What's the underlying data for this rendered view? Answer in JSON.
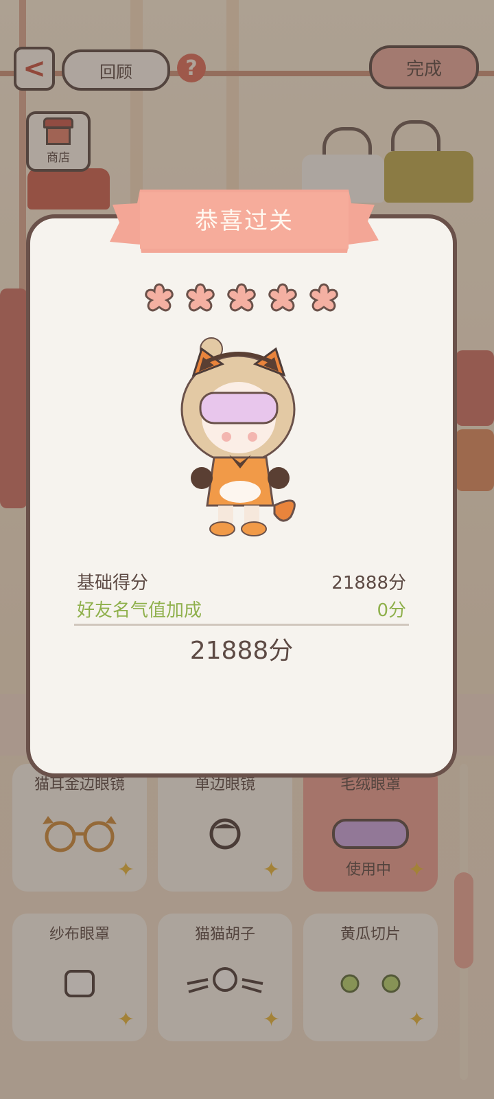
{
  "header": {
    "back_label": "<",
    "review_label": "回顾",
    "help_label": "?",
    "done_label": "完成"
  },
  "shop": {
    "label": "商店"
  },
  "result": {
    "title": "恭喜过关",
    "stars_earned": 5,
    "stars_total": 5,
    "base_score_label": "基础得分",
    "base_score_value": "21888分",
    "bonus_label": "好友名气值加成",
    "bonus_value": "0分",
    "total_value": "21888分"
  },
  "items": [
    {
      "name": "猫耳金边眼镜",
      "icon": "cat-ear-glasses-icon",
      "status": ""
    },
    {
      "name": "单边眼镜",
      "icon": "monocle-icon",
      "status": ""
    },
    {
      "name": "毛绒眼罩",
      "icon": "plush-eye-mask-icon",
      "status": "使用中"
    },
    {
      "name": "纱布眼罩",
      "icon": "gauze-eye-patch-icon",
      "status": ""
    },
    {
      "name": "猫猫胡子",
      "icon": "cat-whiskers-icon",
      "status": ""
    },
    {
      "name": "黄瓜切片",
      "icon": "cucumber-slices-icon",
      "status": ""
    }
  ],
  "colors": {
    "accent": "#e49a8d",
    "ribbon": "#f3a696",
    "outline": "#6a514a",
    "bonus_text": "#8fb04c",
    "star": "#f4b0a2"
  }
}
